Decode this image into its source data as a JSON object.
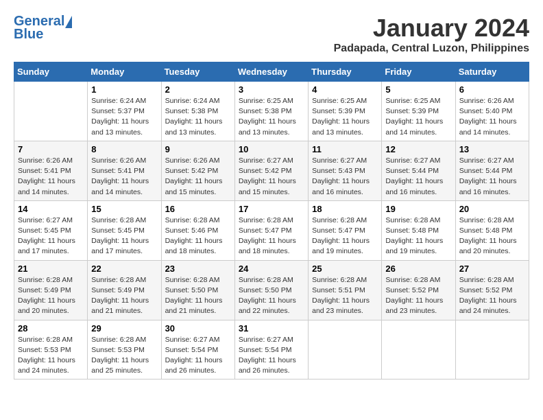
{
  "logo": {
    "general": "General",
    "blue": "Blue"
  },
  "title": "January 2024",
  "location": "Padapada, Central Luzon, Philippines",
  "days_of_week": [
    "Sunday",
    "Monday",
    "Tuesday",
    "Wednesday",
    "Thursday",
    "Friday",
    "Saturday"
  ],
  "weeks": [
    [
      {
        "num": "",
        "info": ""
      },
      {
        "num": "1",
        "info": "Sunrise: 6:24 AM\nSunset: 5:37 PM\nDaylight: 11 hours\nand 13 minutes."
      },
      {
        "num": "2",
        "info": "Sunrise: 6:24 AM\nSunset: 5:38 PM\nDaylight: 11 hours\nand 13 minutes."
      },
      {
        "num": "3",
        "info": "Sunrise: 6:25 AM\nSunset: 5:38 PM\nDaylight: 11 hours\nand 13 minutes."
      },
      {
        "num": "4",
        "info": "Sunrise: 6:25 AM\nSunset: 5:39 PM\nDaylight: 11 hours\nand 13 minutes."
      },
      {
        "num": "5",
        "info": "Sunrise: 6:25 AM\nSunset: 5:39 PM\nDaylight: 11 hours\nand 14 minutes."
      },
      {
        "num": "6",
        "info": "Sunrise: 6:26 AM\nSunset: 5:40 PM\nDaylight: 11 hours\nand 14 minutes."
      }
    ],
    [
      {
        "num": "7",
        "info": "Sunrise: 6:26 AM\nSunset: 5:41 PM\nDaylight: 11 hours\nand 14 minutes."
      },
      {
        "num": "8",
        "info": "Sunrise: 6:26 AM\nSunset: 5:41 PM\nDaylight: 11 hours\nand 14 minutes."
      },
      {
        "num": "9",
        "info": "Sunrise: 6:26 AM\nSunset: 5:42 PM\nDaylight: 11 hours\nand 15 minutes."
      },
      {
        "num": "10",
        "info": "Sunrise: 6:27 AM\nSunset: 5:42 PM\nDaylight: 11 hours\nand 15 minutes."
      },
      {
        "num": "11",
        "info": "Sunrise: 6:27 AM\nSunset: 5:43 PM\nDaylight: 11 hours\nand 16 minutes."
      },
      {
        "num": "12",
        "info": "Sunrise: 6:27 AM\nSunset: 5:44 PM\nDaylight: 11 hours\nand 16 minutes."
      },
      {
        "num": "13",
        "info": "Sunrise: 6:27 AM\nSunset: 5:44 PM\nDaylight: 11 hours\nand 16 minutes."
      }
    ],
    [
      {
        "num": "14",
        "info": "Sunrise: 6:27 AM\nSunset: 5:45 PM\nDaylight: 11 hours\nand 17 minutes."
      },
      {
        "num": "15",
        "info": "Sunrise: 6:28 AM\nSunset: 5:45 PM\nDaylight: 11 hours\nand 17 minutes."
      },
      {
        "num": "16",
        "info": "Sunrise: 6:28 AM\nSunset: 5:46 PM\nDaylight: 11 hours\nand 18 minutes."
      },
      {
        "num": "17",
        "info": "Sunrise: 6:28 AM\nSunset: 5:47 PM\nDaylight: 11 hours\nand 18 minutes."
      },
      {
        "num": "18",
        "info": "Sunrise: 6:28 AM\nSunset: 5:47 PM\nDaylight: 11 hours\nand 19 minutes."
      },
      {
        "num": "19",
        "info": "Sunrise: 6:28 AM\nSunset: 5:48 PM\nDaylight: 11 hours\nand 19 minutes."
      },
      {
        "num": "20",
        "info": "Sunrise: 6:28 AM\nSunset: 5:48 PM\nDaylight: 11 hours\nand 20 minutes."
      }
    ],
    [
      {
        "num": "21",
        "info": "Sunrise: 6:28 AM\nSunset: 5:49 PM\nDaylight: 11 hours\nand 20 minutes."
      },
      {
        "num": "22",
        "info": "Sunrise: 6:28 AM\nSunset: 5:49 PM\nDaylight: 11 hours\nand 21 minutes."
      },
      {
        "num": "23",
        "info": "Sunrise: 6:28 AM\nSunset: 5:50 PM\nDaylight: 11 hours\nand 21 minutes."
      },
      {
        "num": "24",
        "info": "Sunrise: 6:28 AM\nSunset: 5:50 PM\nDaylight: 11 hours\nand 22 minutes."
      },
      {
        "num": "25",
        "info": "Sunrise: 6:28 AM\nSunset: 5:51 PM\nDaylight: 11 hours\nand 23 minutes."
      },
      {
        "num": "26",
        "info": "Sunrise: 6:28 AM\nSunset: 5:52 PM\nDaylight: 11 hours\nand 23 minutes."
      },
      {
        "num": "27",
        "info": "Sunrise: 6:28 AM\nSunset: 5:52 PM\nDaylight: 11 hours\nand 24 minutes."
      }
    ],
    [
      {
        "num": "28",
        "info": "Sunrise: 6:28 AM\nSunset: 5:53 PM\nDaylight: 11 hours\nand 24 minutes."
      },
      {
        "num": "29",
        "info": "Sunrise: 6:28 AM\nSunset: 5:53 PM\nDaylight: 11 hours\nand 25 minutes."
      },
      {
        "num": "30",
        "info": "Sunrise: 6:27 AM\nSunset: 5:54 PM\nDaylight: 11 hours\nand 26 minutes."
      },
      {
        "num": "31",
        "info": "Sunrise: 6:27 AM\nSunset: 5:54 PM\nDaylight: 11 hours\nand 26 minutes."
      },
      {
        "num": "",
        "info": ""
      },
      {
        "num": "",
        "info": ""
      },
      {
        "num": "",
        "info": ""
      }
    ]
  ]
}
